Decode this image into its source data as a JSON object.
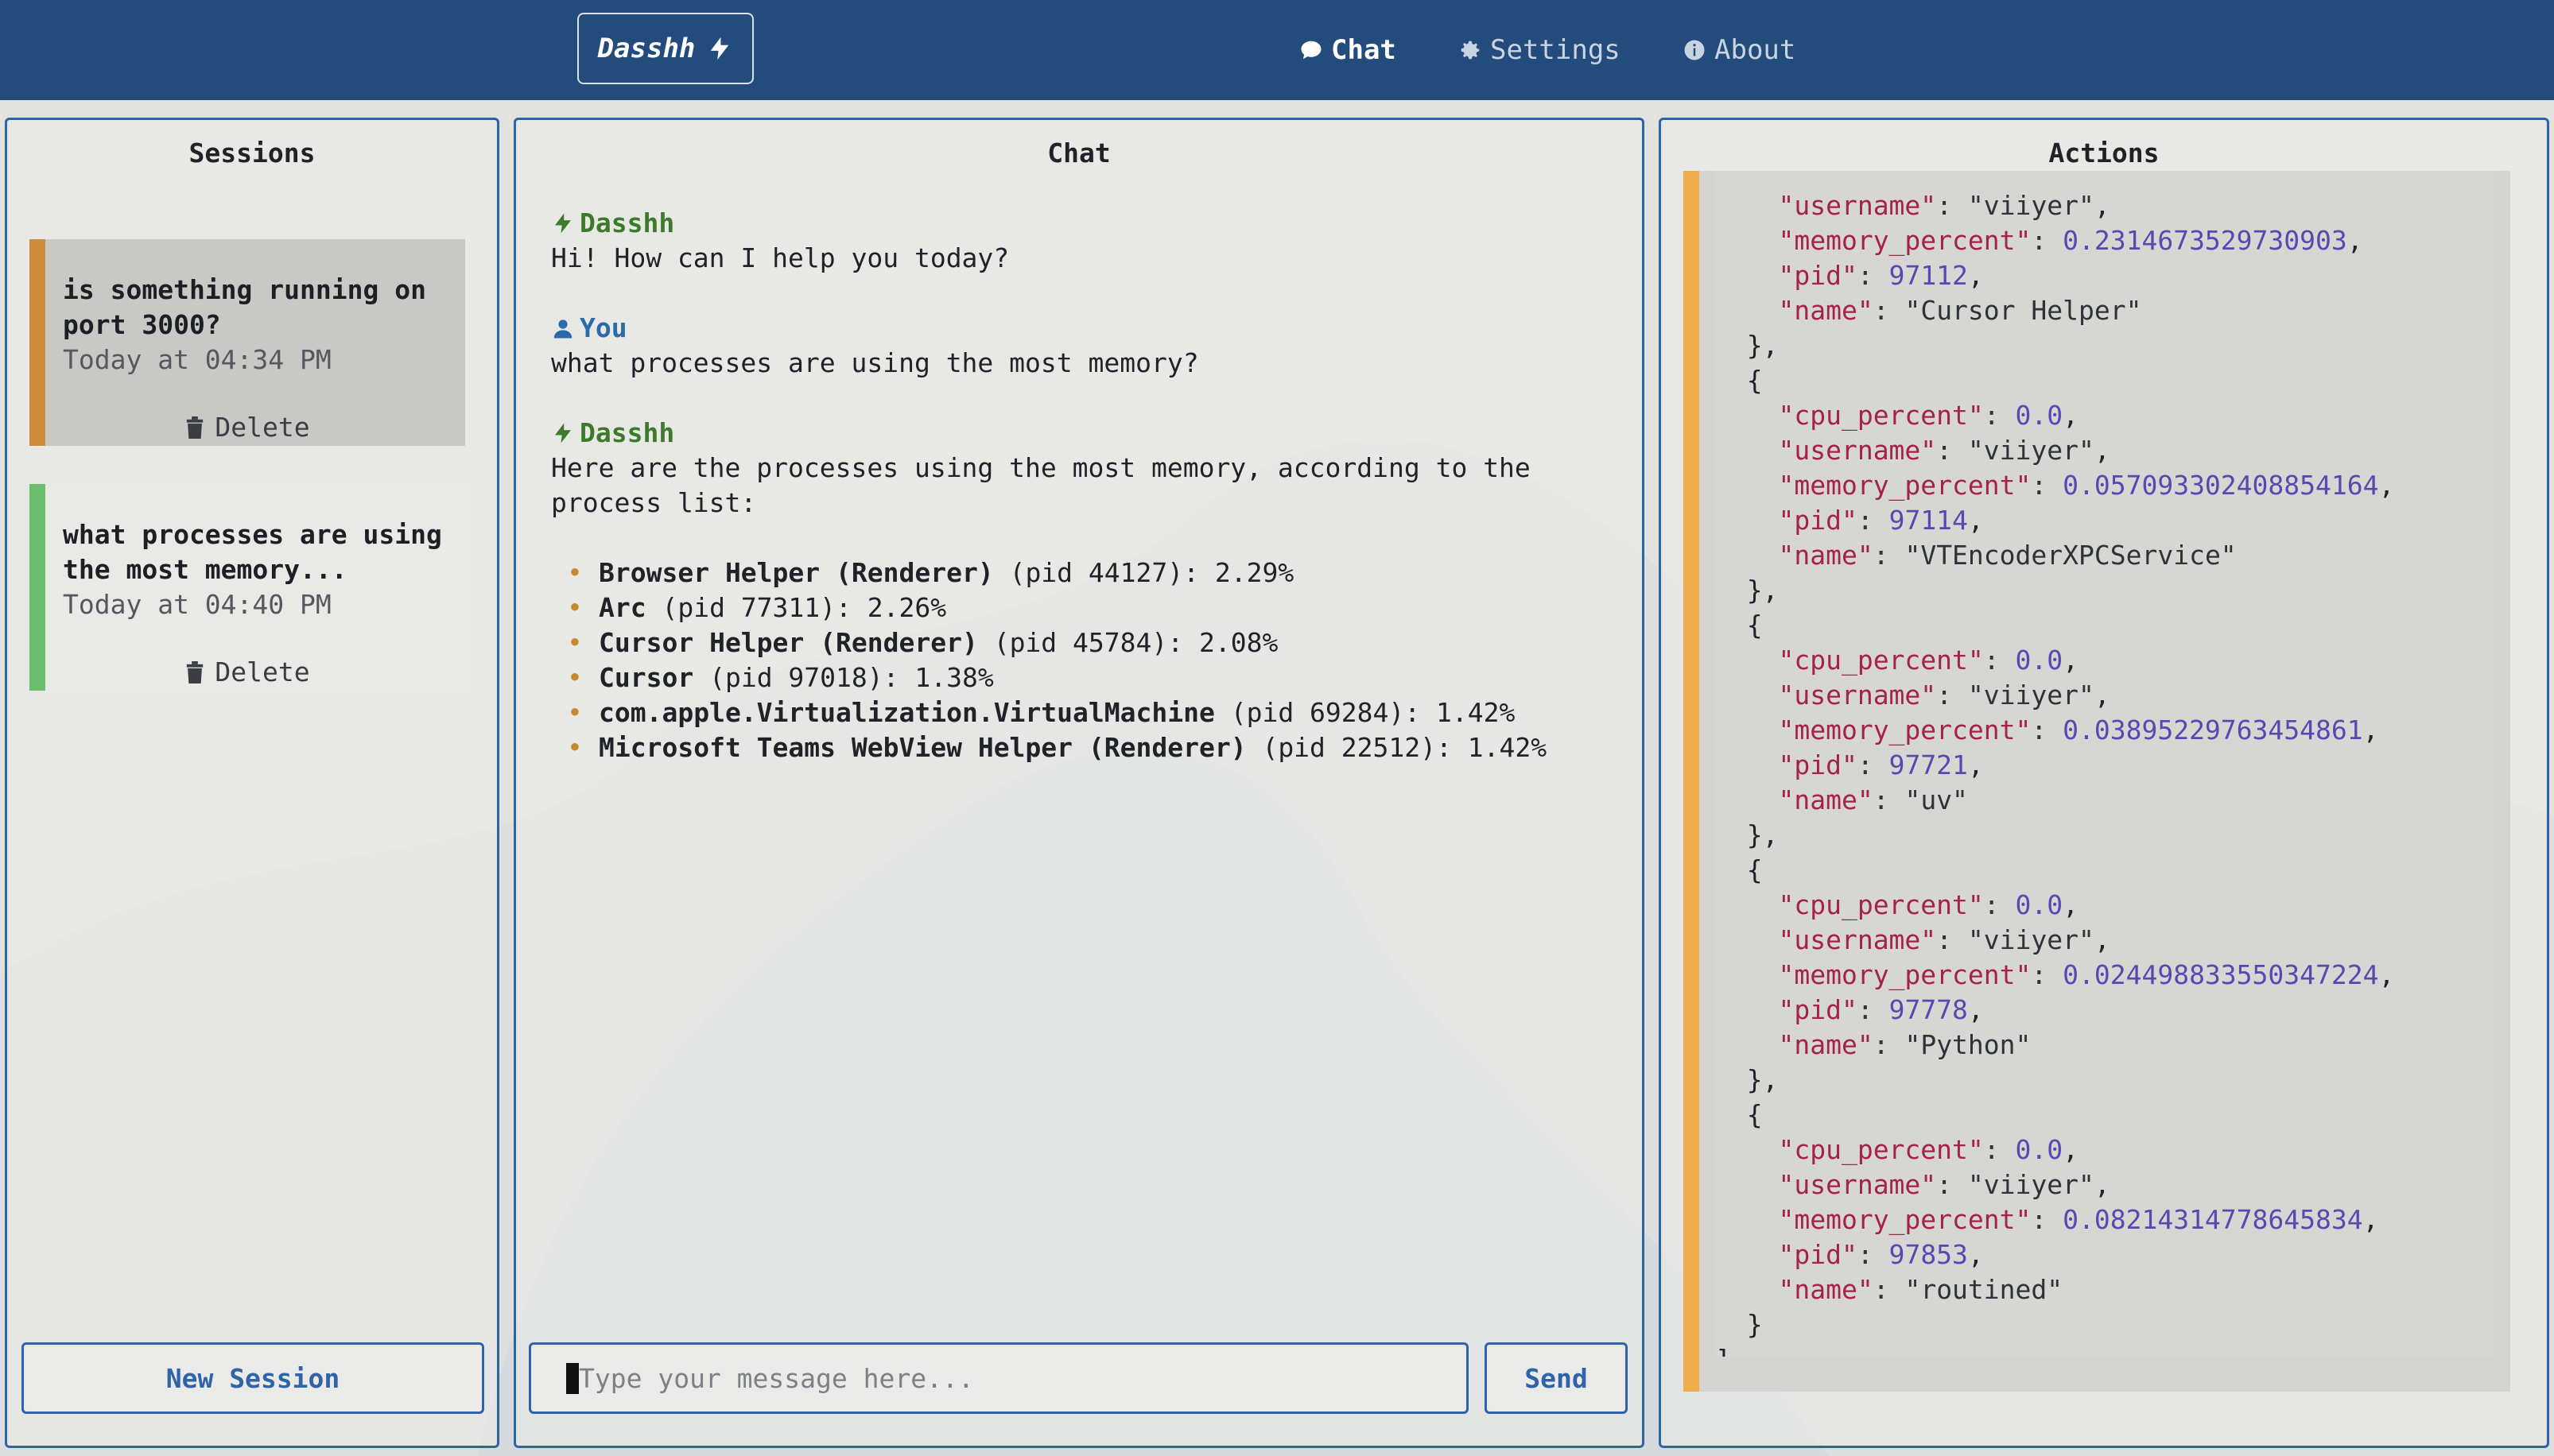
{
  "app": {
    "brand": "Dasshh"
  },
  "nav": [
    {
      "label": "Chat",
      "icon": "chat-bubble-icon",
      "active": true
    },
    {
      "label": "Settings",
      "icon": "gear-icon",
      "active": false
    },
    {
      "label": "About",
      "icon": "info-icon",
      "active": false
    }
  ],
  "sessions": {
    "title": "Sessions",
    "items": [
      {
        "title": "is something running on port 3000?",
        "time": "Today at 04:34 PM",
        "delete_label": "Delete",
        "accent": "#cd8a3b"
      },
      {
        "title": "what processes are using the most memory...",
        "time": "Today at 04:40 PM",
        "delete_label": "Delete",
        "accent": "#6cbf6e"
      }
    ],
    "new_session_label": "New Session"
  },
  "chat": {
    "title": "Chat",
    "messages": [
      {
        "author": "Dasshh",
        "role": "assistant",
        "text": "Hi! How can I help you today?"
      },
      {
        "author": "You",
        "role": "user",
        "text": "what processes are using the most memory?"
      },
      {
        "author": "Dasshh",
        "role": "assistant",
        "text": "Here are the processes using the most memory, according to the process list:",
        "list": [
          {
            "name": "Browser Helper (Renderer)",
            "detail": " (pid 44127): 2.29%"
          },
          {
            "name": "Arc",
            "detail": " (pid 77311): 2.26%"
          },
          {
            "name": "Cursor Helper (Renderer)",
            "detail": " (pid 45784): 2.08%"
          },
          {
            "name": "Cursor",
            "detail": " (pid 97018): 1.38%"
          },
          {
            "name": "com.apple.Virtualization.VirtualMachine",
            "detail": " (pid 69284): 1.42%"
          },
          {
            "name": "Microsoft Teams WebView Helper (Renderer)",
            "detail": " (pid 22512): 1.42%"
          }
        ]
      }
    ],
    "input_placeholder": "Type your message here...",
    "send_label": "Send"
  },
  "actions": {
    "title": "Actions",
    "partial_first": {
      "username": "viiyer",
      "memory_percent": 0.2314673529730903,
      "pid": 97112,
      "name": "Cursor Helper"
    },
    "entries": [
      {
        "cpu_percent": "0.0",
        "username": "viiyer",
        "memory_percent": 0.057093302408854164,
        "pid": 97114,
        "name": "VTEncoderXPCService"
      },
      {
        "cpu_percent": "0.0",
        "username": "viiyer",
        "memory_percent": 0.03895229763454861,
        "pid": 97721,
        "name": "uv"
      },
      {
        "cpu_percent": "0.0",
        "username": "viiyer",
        "memory_percent": 0.024498833550347224,
        "pid": 97778,
        "name": "Python"
      },
      {
        "cpu_percent": "0.0",
        "username": "viiyer",
        "memory_percent": 0.08214314778645834,
        "pid": 97853,
        "name": "routined"
      }
    ]
  },
  "colors": {
    "header_bg": "#234c7c",
    "accent_blue": "#2f64a8",
    "json_key": "#a4234a",
    "json_number": "#5b46b2",
    "action_bar": "#f0ad4e"
  }
}
